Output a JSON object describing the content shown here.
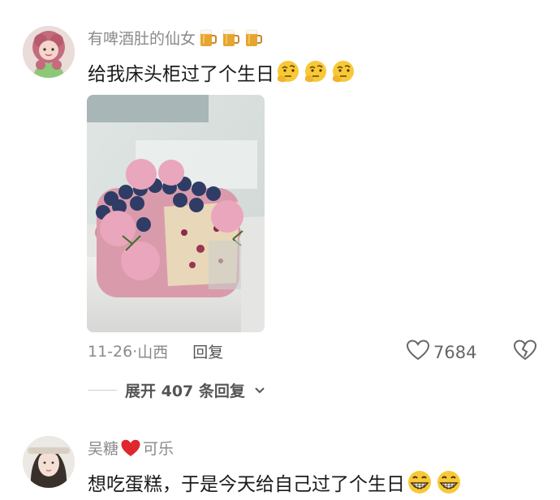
{
  "comments": [
    {
      "username": "有啤酒肚的仙女",
      "username_emojis": [
        "beer-mug-icon",
        "beer-mug-icon",
        "beer-mug-icon"
      ],
      "text": "给我床头柜过了个生日",
      "text_emojis": [
        "thinking-face-icon",
        "thinking-face-icon",
        "thinking-face-icon"
      ],
      "has_image": true,
      "date": "11-26",
      "location_separator": "·",
      "location": "山西",
      "reply_label": "回复",
      "like_count": "7684",
      "expand_label": "展开 407 条回复"
    },
    {
      "username_part1": "吴糖",
      "username_heart": "red-heart-icon",
      "username_part2": "可乐",
      "text": "想吃蛋糕，于是今天给自己过了个生日",
      "text_emojis": [
        "grinning-face-icon",
        "grinning-face-icon"
      ]
    }
  ],
  "colors": {
    "text_primary": "#1a1a1a",
    "text_secondary": "#8a8a8a",
    "heart_red": "#e0262f"
  }
}
